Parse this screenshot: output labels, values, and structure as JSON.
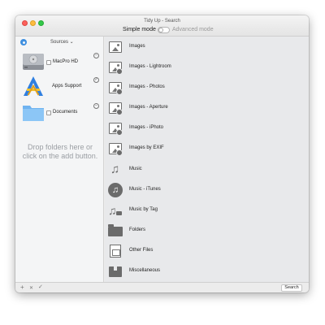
{
  "window": {
    "title": "Tidy Up - Search"
  },
  "mode": {
    "simple_label": "Simple mode",
    "advanced_label": "Advanced mode",
    "advanced_enabled": false
  },
  "sidebar": {
    "header_label": "Sources ⌄",
    "sources": [
      {
        "name": "MacPro HD",
        "icon": "hard-drive-icon",
        "badge": "minus"
      },
      {
        "name": "Apps Support",
        "icon": "applications-folder-icon",
        "badge": "check"
      },
      {
        "name": "Documents",
        "icon": "folder-icon",
        "badge": "minus"
      }
    ],
    "drop_hint": "Drop folders here or click on the add button."
  },
  "categories": [
    {
      "label": "Images",
      "icon": "image-icon"
    },
    {
      "label": "Images - Lightroom",
      "icon": "image-lightroom-icon"
    },
    {
      "label": "Images - Photos",
      "icon": "image-photos-icon"
    },
    {
      "label": "Images - Aperture",
      "icon": "image-aperture-icon"
    },
    {
      "label": "Images - iPhoto",
      "icon": "image-iphoto-icon"
    },
    {
      "label": "Images by EXIF",
      "icon": "image-exif-icon"
    },
    {
      "label": "Music",
      "icon": "music-note-icon"
    },
    {
      "label": "Music - iTunes",
      "icon": "music-itunes-icon"
    },
    {
      "label": "Music by Tag",
      "icon": "music-tag-icon"
    },
    {
      "label": "Folders",
      "icon": "folder-icon"
    },
    {
      "label": "Other Files",
      "icon": "file-icon"
    },
    {
      "label": "Miscellaneous",
      "icon": "box-icon"
    }
  ],
  "bottom_bar": {
    "add_label": "+",
    "remove_label": "✕",
    "confirm_label": "✓",
    "search_label": "Search"
  }
}
